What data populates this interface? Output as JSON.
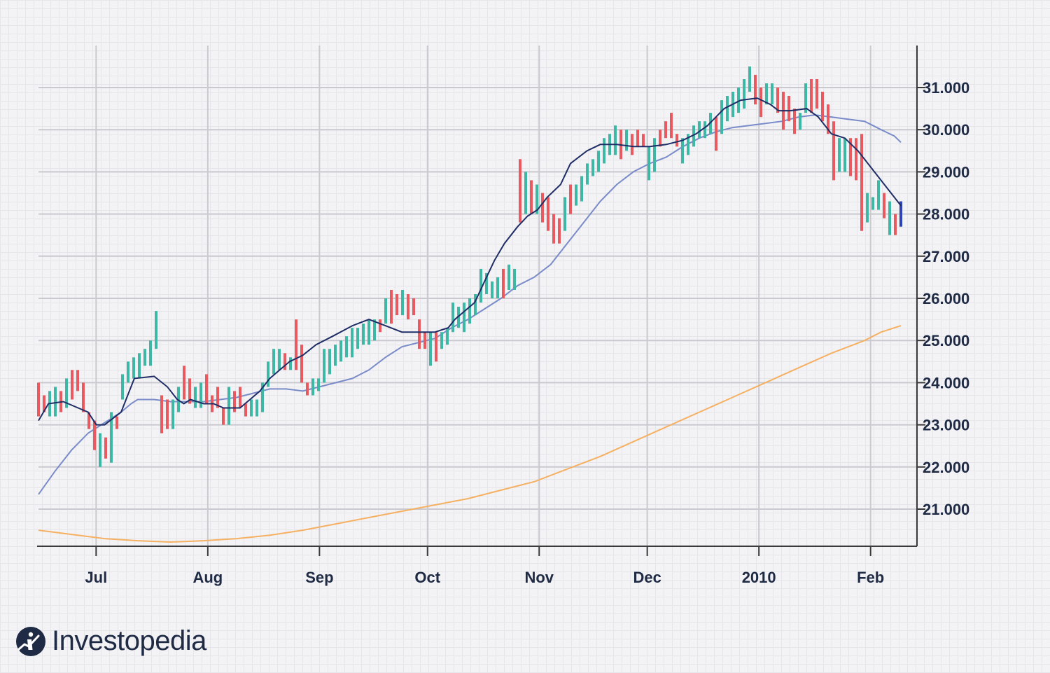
{
  "chart_data": {
    "type": "ohlc",
    "x_tick_labels": [
      "Jul",
      "Aug",
      "Sep",
      "Oct",
      "Nov",
      "Dec",
      "2010",
      "Feb"
    ],
    "y_tick_labels": [
      "31.000",
      "30.000",
      "29.000",
      "28.000",
      "27.000",
      "26.000",
      "25.000",
      "24.000",
      "23.000",
      "22.000",
      "21.000"
    ],
    "y_ticks": [
      31,
      30,
      29,
      28,
      27,
      26,
      25,
      24,
      23,
      22,
      21
    ],
    "ylim": [
      20.2,
      32.0
    ],
    "x_period_start": "Jun 15",
    "x_period_end": "Feb 12",
    "grid": true,
    "colors": {
      "up": "#3fb7a5",
      "down": "#e85a5f",
      "last_bar": "#2f43b8",
      "ma_short": "#1f2d66",
      "ma_medium": "#7a8bc9",
      "ma_long": "#f5b062",
      "axis": "#3a3a3a"
    },
    "bars": [
      {
        "h": 24.0,
        "l": 23.2,
        "dir": "down"
      },
      {
        "h": 23.7,
        "l": 23.3,
        "dir": "down"
      },
      {
        "h": 23.8,
        "l": 23.2,
        "dir": "up"
      },
      {
        "h": 23.9,
        "l": 23.2,
        "dir": "up"
      },
      {
        "h": 23.8,
        "l": 23.3,
        "dir": "down"
      },
      {
        "h": 24.1,
        "l": 23.4,
        "dir": "up"
      },
      {
        "h": 24.3,
        "l": 23.6,
        "dir": "down"
      },
      {
        "h": 24.3,
        "l": 23.8,
        "dir": "down"
      },
      {
        "h": 24.0,
        "l": 23.3,
        "dir": "down"
      },
      {
        "h": 23.3,
        "l": 22.9,
        "dir": "down"
      },
      {
        "h": 23.1,
        "l": 22.4,
        "dir": "down"
      },
      {
        "h": 22.8,
        "l": 22.0,
        "dir": "up"
      },
      {
        "h": 22.7,
        "l": 22.2,
        "dir": "down"
      },
      {
        "h": 23.3,
        "l": 22.1,
        "dir": "up"
      },
      {
        "h": 23.2,
        "l": 22.9,
        "dir": "down"
      },
      {
        "h": 24.2,
        "l": 23.6,
        "dir": "up"
      },
      {
        "h": 24.5,
        "l": 24.0,
        "dir": "up"
      },
      {
        "h": 24.6,
        "l": 24.1,
        "dir": "up"
      },
      {
        "h": 24.7,
        "l": 24.1,
        "dir": "up"
      },
      {
        "h": 24.8,
        "l": 24.4,
        "dir": "up"
      },
      {
        "h": 25.0,
        "l": 24.4,
        "dir": "up"
      },
      {
        "h": 25.7,
        "l": 24.8,
        "dir": "up"
      },
      {
        "h": 23.7,
        "l": 22.8,
        "dir": "down"
      },
      {
        "h": 23.6,
        "l": 22.9,
        "dir": "down"
      },
      {
        "h": 23.6,
        "l": 22.9,
        "dir": "up"
      },
      {
        "h": 23.9,
        "l": 23.3,
        "dir": "up"
      },
      {
        "h": 24.4,
        "l": 23.6,
        "dir": "down"
      },
      {
        "h": 24.1,
        "l": 23.5,
        "dir": "down"
      },
      {
        "h": 23.9,
        "l": 23.4,
        "dir": "up"
      },
      {
        "h": 24.0,
        "l": 23.4,
        "dir": "up"
      },
      {
        "h": 24.2,
        "l": 23.5,
        "dir": "down"
      },
      {
        "h": 23.7,
        "l": 23.3,
        "dir": "down"
      },
      {
        "h": 23.9,
        "l": 23.4,
        "dir": "down"
      },
      {
        "h": 23.4,
        "l": 23.0,
        "dir": "down"
      },
      {
        "h": 23.9,
        "l": 23.0,
        "dir": "up"
      },
      {
        "h": 23.8,
        "l": 23.3,
        "dir": "down"
      },
      {
        "h": 23.9,
        "l": 23.4,
        "dir": "down"
      },
      {
        "h": 23.5,
        "l": 23.2,
        "dir": "down"
      },
      {
        "h": 23.6,
        "l": 23.2,
        "dir": "up"
      },
      {
        "h": 23.6,
        "l": 23.2,
        "dir": "up"
      },
      {
        "h": 24.0,
        "l": 23.3,
        "dir": "up"
      },
      {
        "h": 24.5,
        "l": 23.9,
        "dir": "up"
      },
      {
        "h": 24.8,
        "l": 24.2,
        "dir": "up"
      },
      {
        "h": 24.8,
        "l": 24.3,
        "dir": "up"
      },
      {
        "h": 24.7,
        "l": 24.3,
        "dir": "down"
      },
      {
        "h": 24.6,
        "l": 24.3,
        "dir": "up"
      },
      {
        "h": 25.5,
        "l": 24.3,
        "dir": "down"
      },
      {
        "h": 24.9,
        "l": 24.0,
        "dir": "down"
      },
      {
        "h": 24.0,
        "l": 23.7,
        "dir": "down"
      },
      {
        "h": 24.1,
        "l": 23.7,
        "dir": "up"
      },
      {
        "h": 24.1,
        "l": 23.8,
        "dir": "up"
      },
      {
        "h": 24.8,
        "l": 24.0,
        "dir": "up"
      },
      {
        "h": 24.8,
        "l": 24.2,
        "dir": "up"
      },
      {
        "h": 24.9,
        "l": 24.4,
        "dir": "up"
      },
      {
        "h": 25.0,
        "l": 24.5,
        "dir": "up"
      },
      {
        "h": 25.1,
        "l": 24.6,
        "dir": "up"
      },
      {
        "h": 25.3,
        "l": 24.6,
        "dir": "up"
      },
      {
        "h": 25.3,
        "l": 24.8,
        "dir": "up"
      },
      {
        "h": 25.4,
        "l": 24.9,
        "dir": "up"
      },
      {
        "h": 25.5,
        "l": 24.9,
        "dir": "up"
      },
      {
        "h": 25.5,
        "l": 25.0,
        "dir": "up"
      },
      {
        "h": 25.5,
        "l": 25.2,
        "dir": "down"
      },
      {
        "h": 26.0,
        "l": 25.4,
        "dir": "up"
      },
      {
        "h": 26.2,
        "l": 25.4,
        "dir": "down"
      },
      {
        "h": 26.1,
        "l": 25.6,
        "dir": "down"
      },
      {
        "h": 26.2,
        "l": 25.6,
        "dir": "up"
      },
      {
        "h": 26.1,
        "l": 25.5,
        "dir": "down"
      },
      {
        "h": 26.0,
        "l": 25.6,
        "dir": "down"
      },
      {
        "h": 25.5,
        "l": 24.8,
        "dir": "down"
      },
      {
        "h": 25.2,
        "l": 24.8,
        "dir": "down"
      },
      {
        "h": 25.2,
        "l": 24.4,
        "dir": "up"
      },
      {
        "h": 25.2,
        "l": 24.5,
        "dir": "down"
      },
      {
        "h": 25.2,
        "l": 24.8,
        "dir": "up"
      },
      {
        "h": 25.3,
        "l": 24.9,
        "dir": "up"
      },
      {
        "h": 25.9,
        "l": 25.2,
        "dir": "up"
      },
      {
        "h": 25.8,
        "l": 25.3,
        "dir": "up"
      },
      {
        "h": 25.9,
        "l": 25.2,
        "dir": "up"
      },
      {
        "h": 26.0,
        "l": 25.4,
        "dir": "up"
      },
      {
        "h": 26.1,
        "l": 25.6,
        "dir": "up"
      },
      {
        "h": 26.7,
        "l": 25.9,
        "dir": "up"
      },
      {
        "h": 26.6,
        "l": 26.1,
        "dir": "up"
      },
      {
        "h": 26.4,
        "l": 26.0,
        "dir": "up"
      },
      {
        "h": 26.5,
        "l": 26.0,
        "dir": "up"
      },
      {
        "h": 26.7,
        "l": 26.0,
        "dir": "down"
      },
      {
        "h": 26.8,
        "l": 26.2,
        "dir": "up"
      },
      {
        "h": 26.7,
        "l": 26.2,
        "dir": "up"
      },
      {
        "h": 29.3,
        "l": 27.8,
        "dir": "down"
      },
      {
        "h": 29.0,
        "l": 28.0,
        "dir": "up"
      },
      {
        "h": 28.8,
        "l": 28.0,
        "dir": "down"
      },
      {
        "h": 28.7,
        "l": 28.0,
        "dir": "up"
      },
      {
        "h": 28.5,
        "l": 27.8,
        "dir": "down"
      },
      {
        "h": 28.4,
        "l": 27.6,
        "dir": "down"
      },
      {
        "h": 28.0,
        "l": 27.3,
        "dir": "down"
      },
      {
        "h": 27.9,
        "l": 27.3,
        "dir": "down"
      },
      {
        "h": 28.4,
        "l": 27.6,
        "dir": "up"
      },
      {
        "h": 28.7,
        "l": 28.0,
        "dir": "down"
      },
      {
        "h": 28.7,
        "l": 28.2,
        "dir": "up"
      },
      {
        "h": 28.9,
        "l": 28.3,
        "dir": "up"
      },
      {
        "h": 29.2,
        "l": 28.7,
        "dir": "up"
      },
      {
        "h": 29.3,
        "l": 28.9,
        "dir": "up"
      },
      {
        "h": 29.5,
        "l": 29.0,
        "dir": "up"
      },
      {
        "h": 29.8,
        "l": 29.2,
        "dir": "up"
      },
      {
        "h": 29.9,
        "l": 29.4,
        "dir": "up"
      },
      {
        "h": 30.1,
        "l": 29.4,
        "dir": "up"
      },
      {
        "h": 30.0,
        "l": 29.3,
        "dir": "down"
      },
      {
        "h": 30.0,
        "l": 29.5,
        "dir": "up"
      },
      {
        "h": 29.9,
        "l": 29.4,
        "dir": "down"
      },
      {
        "h": 30.0,
        "l": 29.6,
        "dir": "down"
      },
      {
        "h": 29.9,
        "l": 29.6,
        "dir": "down"
      },
      {
        "h": 29.6,
        "l": 28.8,
        "dir": "up"
      },
      {
        "h": 29.8,
        "l": 29.0,
        "dir": "up"
      },
      {
        "h": 30.0,
        "l": 29.6,
        "dir": "down"
      },
      {
        "h": 30.2,
        "l": 29.8,
        "dir": "down"
      },
      {
        "h": 30.4,
        "l": 29.8,
        "dir": "down"
      },
      {
        "h": 29.9,
        "l": 29.6,
        "dir": "down"
      },
      {
        "h": 29.8,
        "l": 29.2,
        "dir": "up"
      },
      {
        "h": 29.9,
        "l": 29.4,
        "dir": "up"
      },
      {
        "h": 30.1,
        "l": 29.6,
        "dir": "up"
      },
      {
        "h": 30.2,
        "l": 29.8,
        "dir": "up"
      },
      {
        "h": 30.2,
        "l": 29.8,
        "dir": "up"
      },
      {
        "h": 30.4,
        "l": 29.9,
        "dir": "up"
      },
      {
        "h": 30.3,
        "l": 29.5,
        "dir": "down"
      },
      {
        "h": 30.7,
        "l": 29.9,
        "dir": "up"
      },
      {
        "h": 30.8,
        "l": 30.2,
        "dir": "up"
      },
      {
        "h": 30.9,
        "l": 30.3,
        "dir": "up"
      },
      {
        "h": 31.0,
        "l": 30.4,
        "dir": "up"
      },
      {
        "h": 31.2,
        "l": 30.5,
        "dir": "up"
      },
      {
        "h": 31.5,
        "l": 30.9,
        "dir": "up"
      },
      {
        "h": 31.3,
        "l": 30.6,
        "dir": "down"
      },
      {
        "h": 31.0,
        "l": 30.3,
        "dir": "down"
      },
      {
        "h": 31.1,
        "l": 30.6,
        "dir": "up"
      },
      {
        "h": 31.1,
        "l": 30.6,
        "dir": "up"
      },
      {
        "h": 31.0,
        "l": 30.4,
        "dir": "down"
      },
      {
        "h": 30.9,
        "l": 30.0,
        "dir": "down"
      },
      {
        "h": 30.8,
        "l": 30.2,
        "dir": "down"
      },
      {
        "h": 30.5,
        "l": 29.9,
        "dir": "down"
      },
      {
        "h": 30.4,
        "l": 30.0,
        "dir": "up"
      },
      {
        "h": 31.1,
        "l": 30.4,
        "dir": "up"
      },
      {
        "h": 31.2,
        "l": 30.4,
        "dir": "down"
      },
      {
        "h": 31.2,
        "l": 30.5,
        "dir": "down"
      },
      {
        "h": 30.9,
        "l": 30.2,
        "dir": "down"
      },
      {
        "h": 30.6,
        "l": 29.9,
        "dir": "down"
      },
      {
        "h": 30.2,
        "l": 28.8,
        "dir": "down"
      },
      {
        "h": 29.8,
        "l": 29.0,
        "dir": "up"
      },
      {
        "h": 29.8,
        "l": 29.0,
        "dir": "up"
      },
      {
        "h": 29.8,
        "l": 28.9,
        "dir": "down"
      },
      {
        "h": 29.8,
        "l": 28.8,
        "dir": "down"
      },
      {
        "h": 29.9,
        "l": 27.6,
        "dir": "down"
      },
      {
        "h": 28.5,
        "l": 27.8,
        "dir": "up"
      },
      {
        "h": 28.4,
        "l": 28.1,
        "dir": "up"
      },
      {
        "h": 28.8,
        "l": 28.1,
        "dir": "up"
      },
      {
        "h": 28.5,
        "l": 27.9,
        "dir": "down"
      },
      {
        "h": 28.3,
        "l": 27.5,
        "dir": "up"
      },
      {
        "h": 28.0,
        "l": 27.5,
        "dir": "down"
      },
      {
        "h": 28.3,
        "l": 27.7,
        "dir": "last"
      }
    ],
    "ma_short": [
      [
        0,
        23.1
      ],
      [
        6,
        23.5
      ],
      [
        15,
        23.55
      ],
      [
        30,
        23.3
      ],
      [
        35,
        23.0
      ],
      [
        40,
        23.0
      ],
      [
        50,
        23.3
      ],
      [
        58,
        24.1
      ],
      [
        70,
        24.15
      ],
      [
        78,
        23.9
      ],
      [
        84,
        23.6
      ],
      [
        88,
        23.5
      ],
      [
        92,
        23.6
      ],
      [
        100,
        23.5
      ],
      [
        106,
        23.5
      ],
      [
        112,
        23.4
      ],
      [
        122,
        23.4
      ],
      [
        128,
        23.6
      ],
      [
        134,
        23.8
      ],
      [
        140,
        24.1
      ],
      [
        146,
        24.3
      ],
      [
        152,
        24.5
      ],
      [
        160,
        24.65
      ],
      [
        168,
        24.9
      ],
      [
        178,
        25.1
      ],
      [
        190,
        25.35
      ],
      [
        200,
        25.5
      ],
      [
        210,
        25.35
      ],
      [
        220,
        25.2
      ],
      [
        230,
        25.2
      ],
      [
        240,
        25.2
      ],
      [
        244,
        25.25
      ],
      [
        248,
        25.3
      ],
      [
        252,
        25.5
      ],
      [
        258,
        25.7
      ],
      [
        264,
        25.9
      ],
      [
        270,
        26.4
      ],
      [
        276,
        26.9
      ],
      [
        282,
        27.3
      ],
      [
        290,
        27.7
      ],
      [
        296,
        27.95
      ],
      [
        302,
        28.1
      ],
      [
        308,
        28.4
      ],
      [
        316,
        28.7
      ],
      [
        322,
        29.2
      ],
      [
        332,
        29.5
      ],
      [
        340,
        29.65
      ],
      [
        350,
        29.65
      ],
      [
        360,
        29.6
      ],
      [
        370,
        29.6
      ],
      [
        380,
        29.65
      ],
      [
        390,
        29.75
      ],
      [
        398,
        29.9
      ],
      [
        405,
        30.1
      ],
      [
        415,
        30.5
      ],
      [
        425,
        30.7
      ],
      [
        435,
        30.75
      ],
      [
        443,
        30.6
      ],
      [
        448,
        30.45
      ],
      [
        455,
        30.45
      ],
      [
        465,
        30.5
      ],
      [
        472,
        30.3
      ],
      [
        480,
        29.9
      ],
      [
        488,
        29.8
      ],
      [
        496,
        29.5
      ],
      [
        506,
        29.0
      ],
      [
        516,
        28.5
      ],
      [
        522,
        28.2
      ]
    ],
    "ma_medium": [
      [
        0,
        21.35
      ],
      [
        10,
        21.9
      ],
      [
        20,
        22.4
      ],
      [
        30,
        22.8
      ],
      [
        40,
        23.05
      ],
      [
        50,
        23.3
      ],
      [
        56,
        23.5
      ],
      [
        60,
        23.6
      ],
      [
        70,
        23.6
      ],
      [
        80,
        23.55
      ],
      [
        90,
        23.55
      ],
      [
        100,
        23.55
      ],
      [
        110,
        23.6
      ],
      [
        120,
        23.65
      ],
      [
        130,
        23.75
      ],
      [
        140,
        23.85
      ],
      [
        150,
        23.85
      ],
      [
        160,
        23.8
      ],
      [
        170,
        23.9
      ],
      [
        180,
        24.0
      ],
      [
        190,
        24.1
      ],
      [
        200,
        24.3
      ],
      [
        210,
        24.6
      ],
      [
        220,
        24.85
      ],
      [
        230,
        24.95
      ],
      [
        240,
        25.05
      ],
      [
        250,
        25.3
      ],
      [
        260,
        25.5
      ],
      [
        270,
        25.75
      ],
      [
        280,
        26.0
      ],
      [
        290,
        26.3
      ],
      [
        300,
        26.5
      ],
      [
        310,
        26.8
      ],
      [
        320,
        27.3
      ],
      [
        330,
        27.8
      ],
      [
        340,
        28.3
      ],
      [
        350,
        28.7
      ],
      [
        360,
        29.0
      ],
      [
        370,
        29.2
      ],
      [
        380,
        29.35
      ],
      [
        390,
        29.6
      ],
      [
        400,
        29.8
      ],
      [
        410,
        29.95
      ],
      [
        420,
        30.05
      ],
      [
        430,
        30.1
      ],
      [
        440,
        30.15
      ],
      [
        450,
        30.2
      ],
      [
        460,
        30.3
      ],
      [
        470,
        30.35
      ],
      [
        480,
        30.3
      ],
      [
        490,
        30.25
      ],
      [
        500,
        30.2
      ],
      [
        510,
        30.0
      ],
      [
        518,
        29.85
      ],
      [
        522,
        29.7
      ]
    ],
    "ma_long": [
      [
        0,
        20.5
      ],
      [
        20,
        20.4
      ],
      [
        40,
        20.3
      ],
      [
        60,
        20.25
      ],
      [
        80,
        20.22
      ],
      [
        100,
        20.25
      ],
      [
        120,
        20.3
      ],
      [
        140,
        20.38
      ],
      [
        160,
        20.5
      ],
      [
        180,
        20.65
      ],
      [
        200,
        20.8
      ],
      [
        220,
        20.95
      ],
      [
        240,
        21.1
      ],
      [
        260,
        21.25
      ],
      [
        280,
        21.45
      ],
      [
        300,
        21.65
      ],
      [
        320,
        21.95
      ],
      [
        340,
        22.25
      ],
      [
        360,
        22.6
      ],
      [
        380,
        22.95
      ],
      [
        400,
        23.3
      ],
      [
        420,
        23.65
      ],
      [
        440,
        24.0
      ],
      [
        460,
        24.35
      ],
      [
        480,
        24.7
      ],
      [
        500,
        25.0
      ],
      [
        510,
        25.2
      ],
      [
        522,
        25.35
      ]
    ]
  },
  "brand": {
    "name": "Investopedia"
  }
}
